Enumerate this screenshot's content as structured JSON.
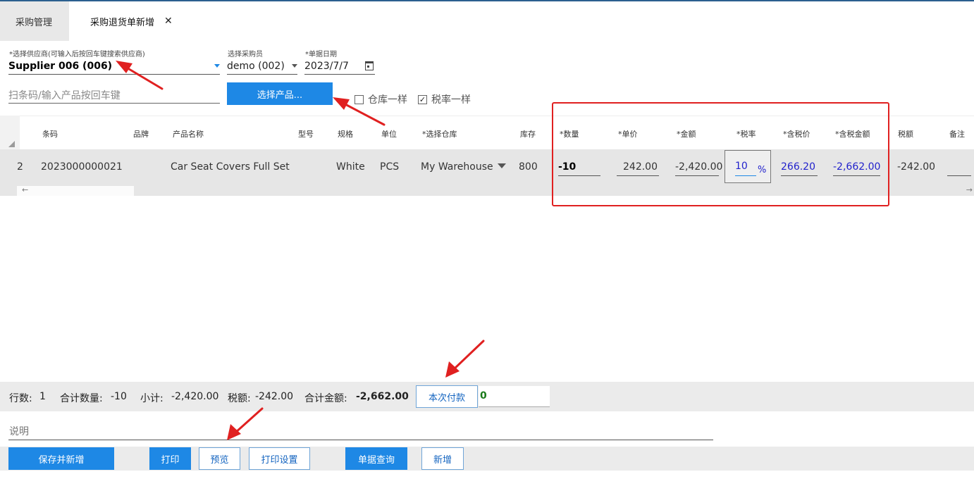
{
  "tabs": [
    {
      "label": "采购管理"
    },
    {
      "label": "采购退货单新增"
    }
  ],
  "tab_close_glyph": "✕",
  "form": {
    "supplier": {
      "label": "*选择供应商(可输入后按回车键搜索供应商)",
      "value": "Supplier 006 (006)"
    },
    "buyer": {
      "label": "选择采购员",
      "value": "demo (002)"
    },
    "date": {
      "label": "*单据日期",
      "value": "2023/7/7"
    },
    "barcode_placeholder": "扫条码/输入产品按回车键",
    "select_product_button": "选择产品...",
    "same_warehouse": {
      "label": "仓库一样",
      "checked": false
    },
    "same_tax_rate": {
      "label": "税率一样",
      "checked": true
    }
  },
  "grid": {
    "columns": [
      "条码",
      "品牌",
      "产品名称",
      "型号",
      "规格",
      "单位",
      "*选择仓库",
      "库存",
      "*数量",
      "*单价",
      "*金额",
      "*税率",
      "*含税价",
      "*含税金额",
      "税额",
      "备注"
    ],
    "rows": [
      {
        "index": "2",
        "barcode": "2023000000021",
        "brand": "",
        "name": "Car Seat Covers Full Set",
        "model": "",
        "spec": "White",
        "unit": "PCS",
        "warehouse": "My Warehouse",
        "stock": "800",
        "qty": "-10",
        "price": "242.00",
        "amount": "-2,420.00",
        "tax_rate": "10",
        "tax_rate_unit": "%",
        "price_with_tax": "266.20",
        "amount_with_tax": "-2,662.00",
        "tax": "-242.00",
        "remark": ""
      }
    ]
  },
  "summary": {
    "rows_label": "行数:",
    "rows_value": "1",
    "qty_label": "合计数量:",
    "qty_value": "-10",
    "subtotal_label": "小计:",
    "subtotal_value": "-2,420.00",
    "tax_label": "税额:",
    "tax_value": "-242.00",
    "total_label": "合计金额:",
    "total_value": "-2,662.00",
    "pay_button": "本次付款",
    "pay_value": "0"
  },
  "memo_label": "说明",
  "actions": {
    "save_new": "保存并新增",
    "print": "打印",
    "preview": "预览",
    "print_settings": "打印设置",
    "query": "单据查询",
    "new": "新增"
  },
  "colors": {
    "primary": "#1e88e5",
    "annotation_red": "#e02020",
    "blue_value": "#2222cc",
    "green_value": "#1a7a1a"
  }
}
